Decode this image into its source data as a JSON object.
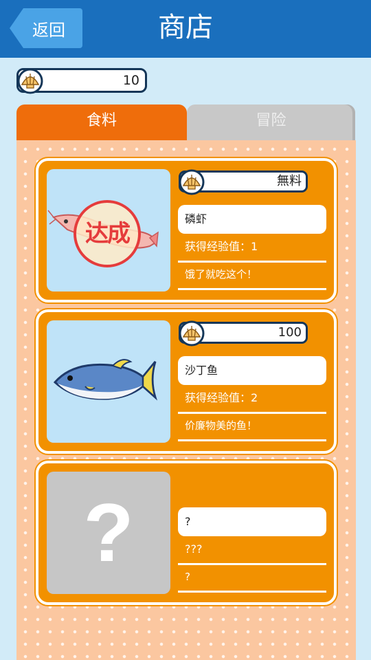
{
  "header": {
    "back_label": "返回",
    "title": "商店"
  },
  "wallet": {
    "coins": "10"
  },
  "tabs": [
    {
      "label": "食料",
      "active": true
    },
    {
      "label": "冒险",
      "active": false
    }
  ],
  "items": [
    {
      "price": "無料",
      "name": "磷虾",
      "exp": "获得经验值：1",
      "desc": "饿了就吃这个！",
      "stamp": "达成",
      "icon": "shrimp-icon"
    },
    {
      "price": "100",
      "name": "沙丁鱼",
      "exp": "获得经验值：2",
      "desc": "价廉物美的鱼！",
      "icon": "sardine-icon"
    },
    {
      "price": "",
      "name": "?",
      "exp": "???",
      "desc": "?",
      "locked_symbol": "?",
      "icon": "question-mark-icon"
    }
  ],
  "colors": {
    "header": "#1a6fbd",
    "accent": "#ef6d0b",
    "card": "#f29100",
    "background": "#d2ebf8"
  }
}
